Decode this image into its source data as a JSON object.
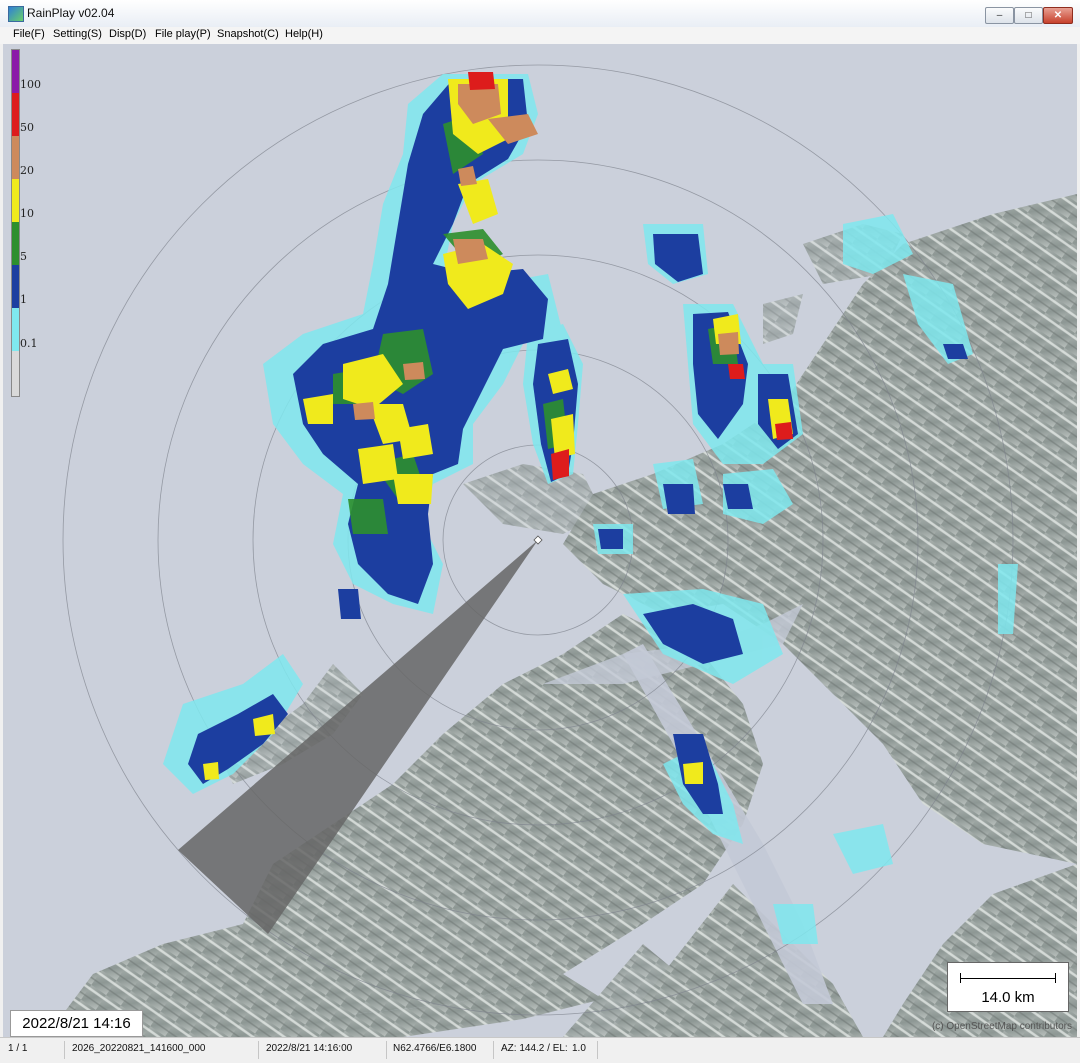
{
  "window": {
    "title": "RainPlay v02.04"
  },
  "menu": [
    "File(F)",
    "Setting(S)",
    "Disp(D)",
    "File play(P)",
    "Snapshot(C)",
    "Help(H)"
  ],
  "legend": {
    "labels": [
      "100",
      "50",
      "20",
      "10",
      "5",
      "1",
      "0.1"
    ],
    "colors": [
      "#8b1aa8",
      "#dd1c1c",
      "#cd8a5c",
      "#f0ea1c",
      "#2d8f2d",
      "#1c3ea0",
      "#7fe8ee",
      "#d9d9d9"
    ]
  },
  "overlay": {
    "timestamp": "2022/8/21 14:16",
    "scale": "14.0 km",
    "attribution": "(c) OpenStreetMap contributors"
  },
  "status": {
    "page": "1 / 1",
    "file": "2026_20220821_141600_000",
    "time": "2022/8/21 14:16:00",
    "coords": "N62.4766/E6.1800",
    "az_el": "AZ: 144.2 / EL:",
    "el_value": "1.0"
  }
}
